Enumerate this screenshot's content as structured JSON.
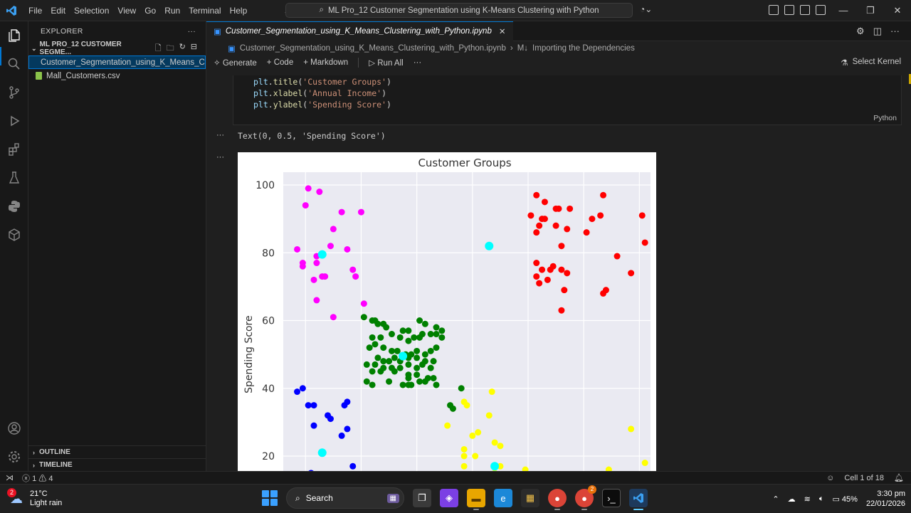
{
  "window": {
    "menu": [
      "File",
      "Edit",
      "Selection",
      "View",
      "Go",
      "Run",
      "Terminal",
      "Help"
    ],
    "search_text": "ML Pro_12 Customer Segmentation using K-Means Clustering with Python"
  },
  "explorer": {
    "header": "EXPLORER",
    "folder": "ML PRO_12 CUSTOMER SEGME...",
    "files": [
      {
        "name": "Customer_Segmentation_using_K_Means_Clu...",
        "icon_color": "#3794ff"
      },
      {
        "name": "Mall_Customers.csv",
        "icon_color": "#8bc34a"
      }
    ],
    "outline": "OUTLINE",
    "timeline": "TIMELINE"
  },
  "editor": {
    "tab_label": "Customer_Segmentation_using_K_Means_Clustering_with_Python.ipynb",
    "breadcrumb_file": "Customer_Segmentation_using_K_Means_Clustering_with_Python.ipynb",
    "breadcrumb_section": "Importing the Dependencies",
    "toolbar": {
      "generate": "Generate",
      "code": "Code",
      "markdown": "Markdown",
      "run_all": "Run All",
      "select_kernel": "Select Kernel"
    },
    "code_lines": [
      {
        "obj": "plt",
        "fn": "title",
        "arg": "'Customer Groups'"
      },
      {
        "obj": "plt",
        "fn": "xlabel",
        "arg": "'Annual Income'"
      },
      {
        "obj": "plt",
        "fn": "ylabel",
        "arg": "'Spending Score'"
      }
    ],
    "cell_language": "Python",
    "output_text": "Text(0, 0.5, 'Spending Score')"
  },
  "chart_data": {
    "type": "scatter",
    "title": "Customer Groups",
    "xlabel": "",
    "ylabel": "Spending Score",
    "ylim": [
      13,
      105
    ],
    "xlim": [
      12,
      144
    ],
    "yticks": [
      20,
      40,
      60,
      80,
      100
    ],
    "grid": true,
    "series": [
      {
        "color": "#ff00ff",
        "points": [
          [
            21,
            99
          ],
          [
            25,
            98
          ],
          [
            20,
            94
          ],
          [
            40,
            92
          ],
          [
            33,
            92
          ],
          [
            30,
            87
          ],
          [
            29,
            82
          ],
          [
            35,
            81
          ],
          [
            17,
            81
          ],
          [
            19,
            77
          ],
          [
            24,
            79
          ],
          [
            24,
            77
          ],
          [
            19,
            76
          ],
          [
            26,
            73
          ],
          [
            27,
            73
          ],
          [
            38,
            73
          ],
          [
            23,
            72
          ],
          [
            37,
            75
          ],
          [
            41,
            65
          ],
          [
            24,
            66
          ],
          [
            30,
            61
          ]
        ]
      },
      {
        "color": "#ff0000",
        "points": [
          [
            103,
            97
          ],
          [
            127,
            97
          ],
          [
            106,
            95
          ],
          [
            110,
            93
          ],
          [
            111,
            93
          ],
          [
            115,
            93
          ],
          [
            126,
            91
          ],
          [
            101,
            91
          ],
          [
            141,
            91
          ],
          [
            123,
            90
          ],
          [
            106,
            90
          ],
          [
            104,
            88
          ],
          [
            110,
            88
          ],
          [
            121,
            86
          ],
          [
            103,
            86
          ],
          [
            114,
            87
          ],
          [
            105,
            90
          ],
          [
            112,
            82
          ],
          [
            132,
            79
          ],
          [
            109,
            76
          ],
          [
            103,
            73
          ],
          [
            114,
            74
          ],
          [
            108,
            75
          ],
          [
            112,
            75
          ],
          [
            103,
            77
          ],
          [
            104,
            71
          ],
          [
            107,
            72
          ],
          [
            105,
            75
          ],
          [
            113,
            69
          ],
          [
            127,
            68
          ],
          [
            128,
            69
          ],
          [
            142,
            83
          ],
          [
            137,
            74
          ],
          [
            112,
            63
          ]
        ]
      },
      {
        "color": "#008000",
        "points": [
          [
            41,
            61
          ],
          [
            44,
            60
          ],
          [
            45,
            60
          ],
          [
            48,
            59
          ],
          [
            46,
            59
          ],
          [
            49,
            58
          ],
          [
            55,
            57
          ],
          [
            57,
            57
          ],
          [
            61,
            60
          ],
          [
            63,
            59
          ],
          [
            67,
            58
          ],
          [
            69,
            57
          ],
          [
            62,
            56
          ],
          [
            59,
            55
          ],
          [
            65,
            56
          ],
          [
            44,
            55
          ],
          [
            47,
            55
          ],
          [
            51,
            56
          ],
          [
            54,
            55
          ],
          [
            57,
            54
          ],
          [
            61,
            55
          ],
          [
            67,
            56
          ],
          [
            69,
            55
          ],
          [
            43,
            52
          ],
          [
            45,
            53
          ],
          [
            48,
            52
          ],
          [
            51,
            51
          ],
          [
            53,
            51
          ],
          [
            56,
            50
          ],
          [
            58,
            50
          ],
          [
            60,
            51
          ],
          [
            63,
            50
          ],
          [
            65,
            51
          ],
          [
            67,
            52
          ],
          [
            46,
            49
          ],
          [
            48,
            48
          ],
          [
            50,
            48
          ],
          [
            52,
            49
          ],
          [
            54,
            48
          ],
          [
            57,
            49
          ],
          [
            60,
            49
          ],
          [
            63,
            48
          ],
          [
            66,
            48
          ],
          [
            42,
            47
          ],
          [
            45,
            47
          ],
          [
            48,
            46
          ],
          [
            51,
            46
          ],
          [
            54,
            46
          ],
          [
            57,
            47
          ],
          [
            60,
            46
          ],
          [
            62,
            47
          ],
          [
            65,
            46
          ],
          [
            44,
            45
          ],
          [
            47,
            45
          ],
          [
            52,
            45
          ],
          [
            57,
            44
          ],
          [
            60,
            44
          ],
          [
            64,
            43
          ],
          [
            42,
            42
          ],
          [
            44,
            41
          ],
          [
            50,
            42
          ],
          [
            55,
            41
          ],
          [
            58,
            41
          ],
          [
            61,
            42
          ],
          [
            63,
            42
          ],
          [
            66,
            43
          ],
          [
            67,
            41
          ],
          [
            76,
            40
          ],
          [
            72,
            35
          ],
          [
            73,
            34
          ],
          [
            57,
            43
          ],
          [
            57,
            41
          ]
        ]
      },
      {
        "color": "#0000ff",
        "points": [
          [
            17,
            39
          ],
          [
            19,
            40
          ],
          [
            21,
            35
          ],
          [
            23,
            35
          ],
          [
            28,
            32
          ],
          [
            29,
            31
          ],
          [
            23,
            29
          ],
          [
            34,
            35
          ],
          [
            35,
            36
          ],
          [
            35,
            28
          ],
          [
            33,
            26
          ],
          [
            37,
            17
          ],
          [
            22,
            15
          ]
        ]
      },
      {
        "color": "#ffff00",
        "points": [
          [
            77,
            36
          ],
          [
            78,
            35
          ],
          [
            87,
            39
          ],
          [
            86,
            32
          ],
          [
            71,
            29
          ],
          [
            80,
            26
          ],
          [
            82,
            27
          ],
          [
            88,
            24
          ],
          [
            90,
            23
          ],
          [
            77,
            22
          ],
          [
            77,
            20
          ],
          [
            81,
            20
          ],
          [
            77,
            17
          ],
          [
            90,
            17
          ],
          [
            99,
            16
          ],
          [
            88,
            15
          ],
          [
            129,
            16
          ],
          [
            137,
            28
          ],
          [
            142,
            18
          ]
        ]
      },
      {
        "color": "#00ffff",
        "points": [
          [
            26,
            79.5
          ],
          [
            55,
            49.5
          ],
          [
            86,
            82
          ],
          [
            26,
            21
          ],
          [
            88,
            17
          ]
        ]
      }
    ]
  },
  "status": {
    "errors": "1",
    "warnings": "4",
    "cell_info": "Cell 1 of 18"
  },
  "taskbar": {
    "temperature": "21°C",
    "weather": "Light rain",
    "weather_badge": "2",
    "search": "Search",
    "chrome_badge": "2",
    "battery": "45%",
    "time": "3:30 pm",
    "date": "22/01/2026"
  }
}
